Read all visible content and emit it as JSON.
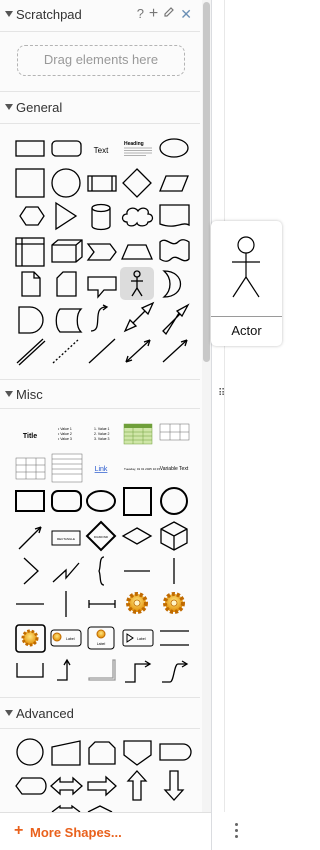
{
  "sections": {
    "scratchpad": {
      "title": "Scratchpad",
      "drop_hint": "Drag elements here",
      "icons": [
        "help-icon",
        "add-icon",
        "edit-icon",
        "close-icon"
      ]
    },
    "general": {
      "title": "General"
    },
    "misc": {
      "title": "Misc"
    },
    "advanced": {
      "title": "Advanced"
    }
  },
  "shape_labels": {
    "text": "Text",
    "heading": "Heading",
    "title": "Title",
    "link": "Link",
    "variable_text": "Variable Text",
    "textbox": "TEXTBOX",
    "rectangle": "RECTANGLE",
    "diamond": "DIAMOND",
    "label": "Label"
  },
  "tooltip": {
    "label": "Actor"
  },
  "footer": {
    "more_shapes": "More Shapes..."
  },
  "colors": {
    "accent": "#e9611c",
    "shape_stroke": "#000000",
    "highlight": "#dcdcdc"
  }
}
